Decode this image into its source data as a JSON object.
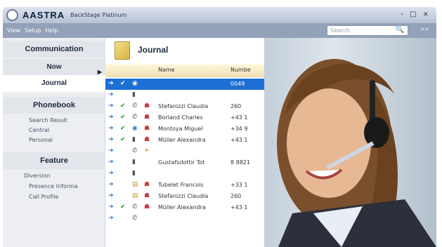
{
  "window": {
    "brand": "AASTRA",
    "title": "BackStage Platinum",
    "controls": "- □ ×"
  },
  "menu": [
    "View",
    "Setup",
    "Help"
  ],
  "search": {
    "placeholder": "Search",
    "more": ">>"
  },
  "sidebar": {
    "communication": "Communication",
    "now": "Now",
    "journal": "Journal",
    "phonebook": "Phonebook",
    "phonebook_items": [
      "Search Result",
      "Central",
      "Personal"
    ],
    "feature": "Feature",
    "feature_items": [
      "Diversion",
      "Presence Informa",
      "Call Profile"
    ]
  },
  "journal": {
    "title": "Journal",
    "columns": [
      "Name",
      "Numbe"
    ],
    "rows": [
      {
        "name": "",
        "number": "0049",
        "icons": [
          "arrow",
          "check",
          "globe"
        ],
        "selected": true
      },
      {
        "name": "",
        "number": "",
        "icons": [
          "arrow",
          "",
          "phone"
        ]
      },
      {
        "name": "Stefanizzi Claudia",
        "number": "260",
        "icons": [
          "arrow",
          "check",
          "handset",
          "contact"
        ]
      },
      {
        "name": "Borland Charles",
        "number": "+43 1",
        "icons": [
          "arrow",
          "check",
          "handset",
          "contact"
        ]
      },
      {
        "name": "Montoya Miguel",
        "number": "+34 9",
        "icons": [
          "arrow",
          "check",
          "globe",
          "contact"
        ]
      },
      {
        "name": "Müller Alexandra",
        "number": "+43 1",
        "icons": [
          "arrow",
          "check",
          "phone",
          "contact"
        ]
      },
      {
        "name": "",
        "number": "",
        "icons": [
          "arrow",
          "",
          "handset",
          "star"
        ]
      },
      {
        "name": "Gustafsdottir Tot",
        "number": "8 8821",
        "icons": [
          "arrow",
          "",
          "phone"
        ]
      },
      {
        "name": "",
        "number": "",
        "icons": [
          "arrow",
          "",
          "phone"
        ]
      },
      {
        "name": "Tubelet Francois",
        "number": "+33 1",
        "icons": [
          "arrow",
          "",
          "note",
          "contact"
        ]
      },
      {
        "name": "Stefanizzi Claudia",
        "number": "260",
        "icons": [
          "arrow",
          "",
          "note",
          "contact"
        ]
      },
      {
        "name": "Müller Alexandra",
        "number": "+43 1",
        "icons": [
          "arrow",
          "check",
          "handset",
          "contact"
        ]
      },
      {
        "name": "",
        "number": "",
        "icons": [
          "arrow",
          "",
          "handset"
        ]
      }
    ]
  }
}
